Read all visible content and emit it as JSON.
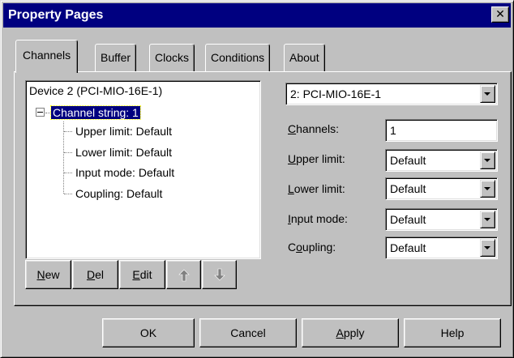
{
  "window": {
    "title": "Property Pages",
    "close_glyph": "✕"
  },
  "tabs": [
    {
      "label": "Channels",
      "active": true
    },
    {
      "label": "Buffer",
      "active": false
    },
    {
      "label": "Clocks",
      "active": false
    },
    {
      "label": "Conditions",
      "active": false
    },
    {
      "label": "About",
      "active": false
    }
  ],
  "tree": {
    "root": "Device 2 (PCI-MIO-16E-1)",
    "channel": "Channel string: 1",
    "children": [
      "Upper limit: Default",
      "Lower limit: Default",
      "Input mode: Default",
      "Coupling: Default"
    ]
  },
  "tree_buttons": {
    "new": {
      "mnemonic": "N",
      "rest": "ew"
    },
    "del": {
      "mnemonic": "D",
      "rest": "el"
    },
    "edit": {
      "mnemonic": "E",
      "rest": "dit"
    },
    "up_icon": "arrow-up-icon",
    "down_icon": "arrow-down-icon"
  },
  "device_select": {
    "value": "2: PCI-MIO-16E-1"
  },
  "fields": {
    "channels": {
      "label_mnemonic": "C",
      "label_rest": "hannels:",
      "value": "1"
    },
    "upper_limit": {
      "label_mnemonic": "U",
      "label_rest": "pper limit:",
      "value": "Default"
    },
    "lower_limit": {
      "label_mnemonic": "L",
      "label_rest": "ower limit:",
      "value": "Default"
    },
    "input_mode": {
      "label_mnemonic": "I",
      "label_rest": "nput mode:",
      "value": "Default"
    },
    "coupling": {
      "label_pre": "C",
      "label_mnemonic": "o",
      "label_rest": "upling:",
      "value": "Default"
    }
  },
  "dialog_buttons": {
    "ok": "OK",
    "cancel": "Cancel",
    "apply": {
      "mnemonic": "A",
      "rest": "pply"
    },
    "help": "Help"
  },
  "colors": {
    "face": "#c0c0c0",
    "titlebar": "#000080",
    "selection": "#000080"
  }
}
